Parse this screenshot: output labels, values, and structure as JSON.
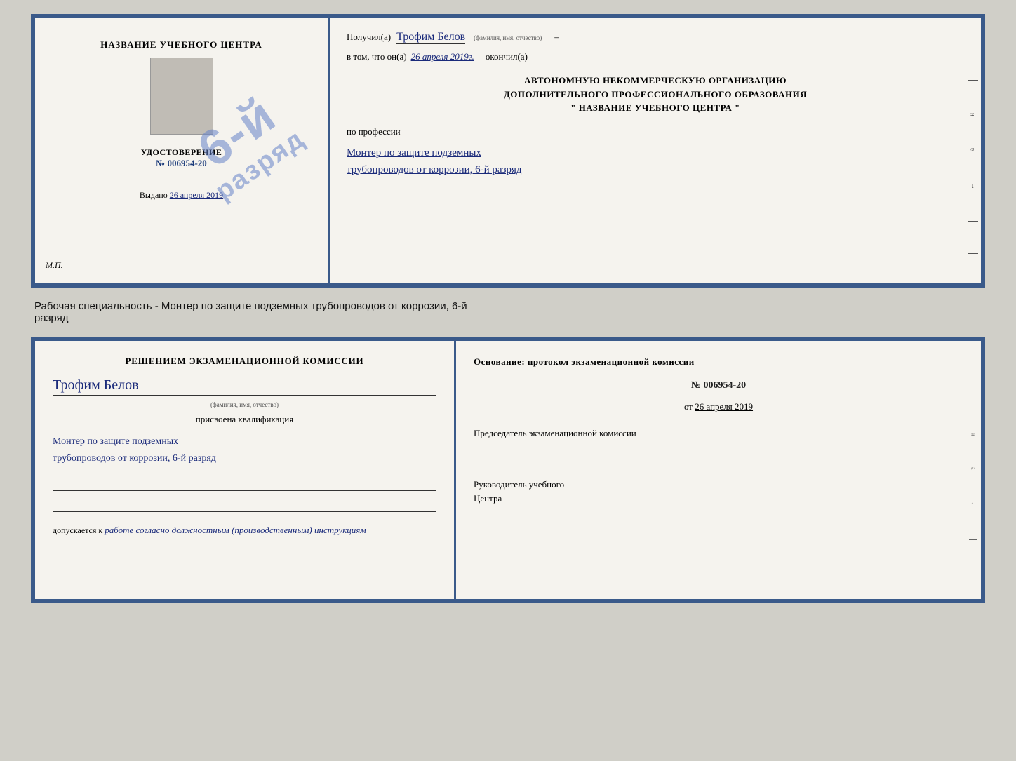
{
  "top_cert": {
    "left": {
      "header": "НАЗВАНИЕ УЧЕБНОГО ЦЕНТРА",
      "udost_title": "УДОСТОВЕРЕНИЕ",
      "udost_num": "№ 006954-20",
      "vydano_label": "Выдано",
      "vydano_date": "26 апреля 2019",
      "mp": "М.П."
    },
    "stamp": {
      "line1": "6-й",
      "line2": "разряд"
    },
    "right": {
      "poluchil_label": "Получил(а)",
      "poluchil_name": "Трофим Белов",
      "fio_small": "(фамилия, имя, отчество)",
      "vtom_label": "в том, что он(а)",
      "vtom_date": "26 апреля 2019г.",
      "okonchil_label": "окончил(а)",
      "org_line1": "АВТОНОМНУЮ НЕКОММЕРЧЕСКУЮ ОРГАНИЗАЦИЮ",
      "org_line2": "ДОПОЛНИТЕЛЬНОГО ПРОФЕССИОНАЛЬНОГО ОБРАЗОВАНИЯ",
      "org_line3": "\"  НАЗВАНИЕ УЧЕБНОГО ЦЕНТРА  \"",
      "po_professii": "по профессии",
      "qualification_line1": "Монтер по защите подземных",
      "qualification_line2": "трубопроводов от коррозии, 6-й разряд"
    }
  },
  "middle_label": {
    "text_line1": "Рабочая специальность - Монтер по защите подземных трубопроводов от коррозии, 6-й",
    "text_line2": "разряд"
  },
  "bottom_cert": {
    "left": {
      "decision_title": "Решением экзаменационной комиссии",
      "name": "Трофим Белов",
      "fio_small": "(фамилия, имя, отчество)",
      "prisvoena": "присвоена квалификация",
      "qual_line1": "Монтер по защите подземных",
      "qual_line2": "трубопроводов от коррозии, 6-й разряд",
      "dopuskaetsya_prefix": "допускается к",
      "dopuskaetsya_text": "работе согласно должностным (производственным) инструкциям"
    },
    "right": {
      "osnov_title": "Основание: протокол экзаменационной комиссии",
      "protocol_num": "№ 006954-20",
      "ot_label": "от",
      "ot_date": "26 апреля 2019",
      "predsedatel_title": "Председатель экзаменационной комиссии",
      "rukov_title_line1": "Руководитель учебного",
      "rukov_title_line2": "Центра"
    }
  }
}
